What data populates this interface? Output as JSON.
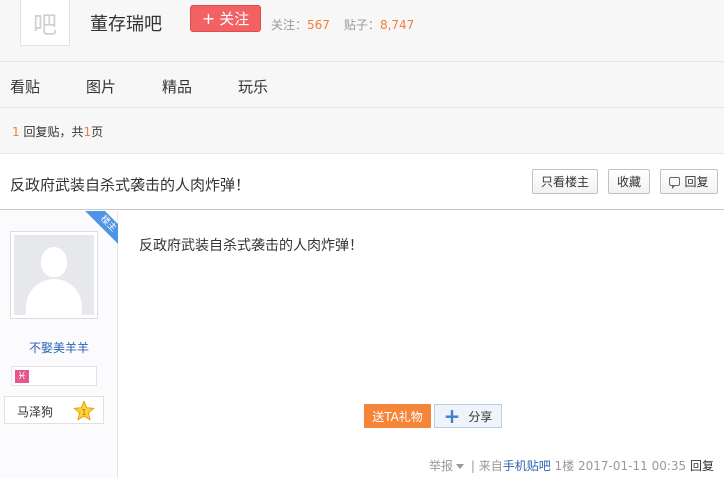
{
  "header": {
    "forum_avatar_char": "吧",
    "forum_name": "董存瑞吧",
    "follow_label": "关注",
    "follow_plus": "+",
    "stats": {
      "followers_label": "关注：",
      "followers_value": "567",
      "posts_label": "贴子：",
      "posts_value": "8,747"
    }
  },
  "tabs": [
    {
      "label": "看贴"
    },
    {
      "label": "图片"
    },
    {
      "label": "精品"
    },
    {
      "label": "玩乐"
    }
  ],
  "pager": {
    "reply_count": "1",
    "reply_label": "回复贴，共",
    "page_count": "1",
    "page_label": "页"
  },
  "thread": {
    "title": "反政府武装自杀式袭击的人肉炸弹！",
    "only_op_label": "只看楼主",
    "favorite_label": "收藏",
    "reply_label": "回复"
  },
  "post": {
    "author_name": "不娶美羊羊",
    "op_badge": "楼主",
    "constellation_glyph": "♓",
    "level_title": "马泽狗",
    "content": "反政府武装自杀式袭击的人肉炸弹！",
    "gift_label": "送TA礼物",
    "share_label": "分享",
    "share_plus": "+",
    "footer": {
      "report_label": "举报",
      "separator": "|",
      "source_prefix": "来自",
      "source_link": "手机贴吧",
      "floor": "1楼",
      "timestamp": "2017-01-11 00:35",
      "reply_label": "回复"
    }
  },
  "colors": {
    "accent_red": "#f36263",
    "number_orange": "#f57d3b",
    "link_blue": "#2d64b3",
    "gift_orange": "#f58539",
    "op_ribbon_blue": "#4f94e6"
  },
  "icons": {
    "star": "level-star-icon",
    "reply": "reply-bubble-icon",
    "share": "share-plus-icon",
    "constellation": "pisces-icon"
  }
}
